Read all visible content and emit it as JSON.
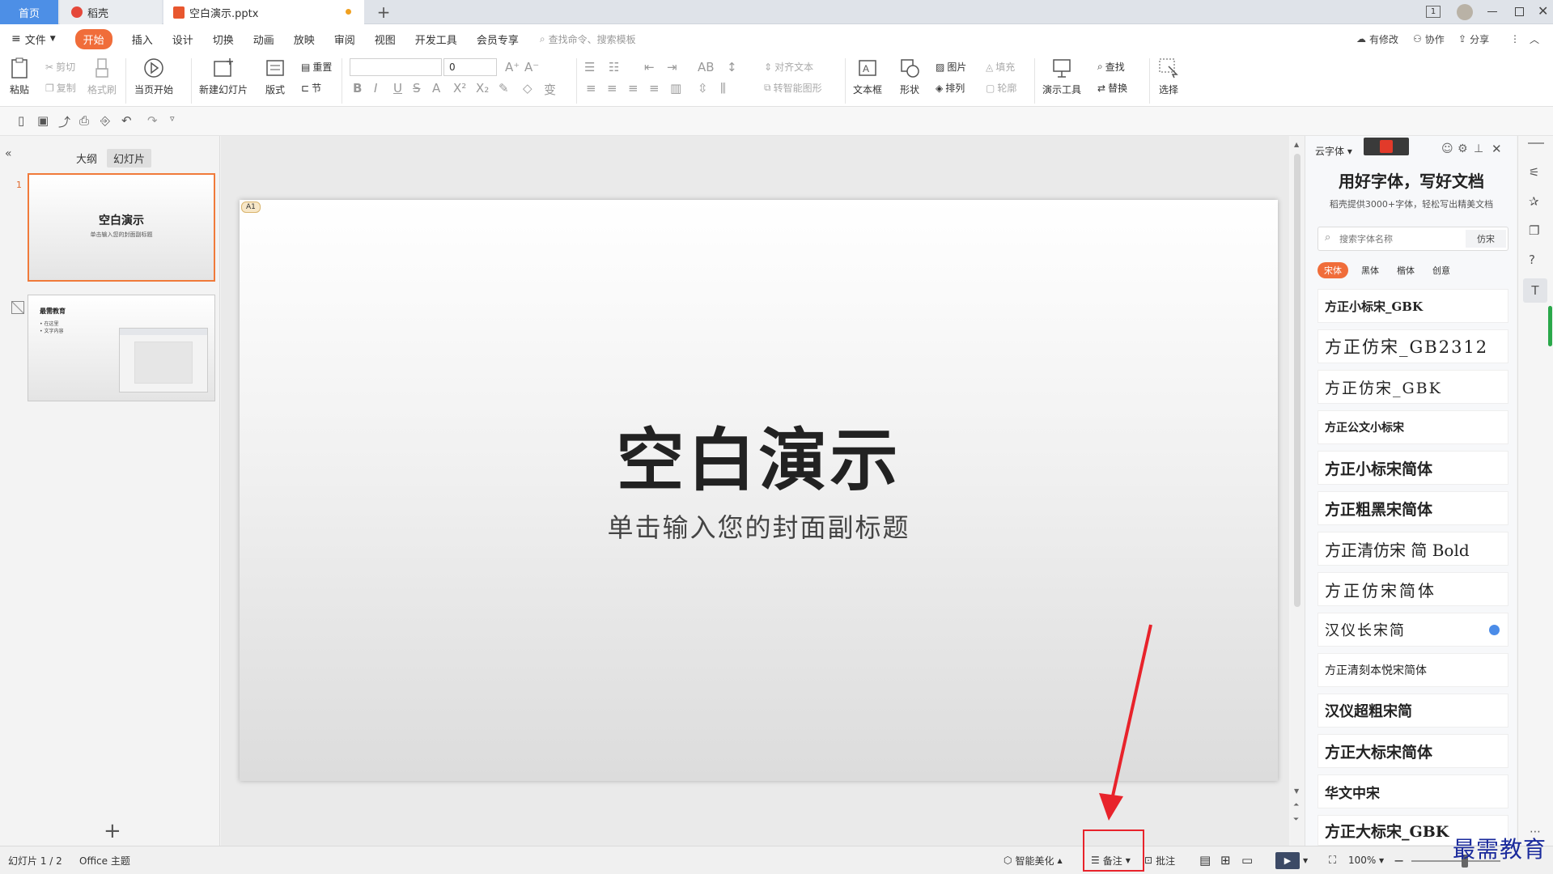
{
  "tabs": {
    "home": "首页",
    "daoke": "稻壳",
    "file": "空白演示.pptx",
    "new_tab": "+"
  },
  "window": {
    "badge": "1"
  },
  "menu": {
    "file": "文件",
    "items": [
      "开始",
      "插入",
      "设计",
      "切换",
      "动画",
      "放映",
      "审阅",
      "视图",
      "开发工具",
      "会员专享"
    ],
    "search": "查找命令、搜索模板",
    "has_changes": "有修改",
    "collab": "协作",
    "share": "分享"
  },
  "ribbon": {
    "paste": "粘贴",
    "cut": "剪切",
    "copy": "复制",
    "format_painter": "格式刷",
    "from_current": "当页开始",
    "new_slide": "新建幻灯片",
    "layout": "版式",
    "reset": "重置",
    "section": "节",
    "font_size": "0",
    "align_text": "对齐文本",
    "smart_art": "转智能图形",
    "textbox": "文本框",
    "shape": "形状",
    "picture": "图片",
    "arrange": "排列",
    "fill": "填充",
    "outline": "轮廓",
    "present_tools": "演示工具",
    "find": "查找",
    "replace": "替换",
    "select": "选择"
  },
  "left_panel": {
    "outline_tab": "大纲",
    "slides_tab": "幻灯片",
    "slide1_no": "1",
    "thumb1_title": "空白演示",
    "thumb1_sub": "单击输入您的封面副标题",
    "thumb2_title": "最需教育",
    "thumb2_b1": "• 在这里",
    "thumb2_b2": "• 文字内容",
    "add_slide": "+"
  },
  "slide": {
    "title": "空白演示",
    "subtitle": "单击输入您的封面副标题",
    "tag": "A1"
  },
  "font_panel": {
    "cloud_font": "云字体",
    "headline": "用好字体，写好文档",
    "sub": "稻壳提供3000+字体，轻松写出精美文档",
    "search_placeholder": "搜索字体名称",
    "search_value": "仿宋",
    "categories": [
      "宋体",
      "黑体",
      "楷体",
      "创意"
    ],
    "fonts": [
      "方正小标宋_GBK",
      "方正仿宋_GB2312",
      "方正仿宋_GBK",
      "方正公文小标宋",
      "方正小标宋简体",
      "方正粗黑宋简体",
      "方正清仿宋 简 Bold",
      "方正仿宋简体",
      "汉仪长宋简",
      "方正清刻本悦宋简体",
      "汉仪超粗宋简",
      "方正大标宋简体",
      "华文中宋",
      "方正大标宋_GBK"
    ]
  },
  "status": {
    "slide_count": "幻灯片 1 / 2",
    "theme": "Office 主题",
    "beautify": "智能美化",
    "notes": "备注",
    "comments": "批注",
    "zoom": "100%"
  },
  "watermark": "最需教育",
  "colors": {
    "accent": "#f06d3a",
    "tab_home": "#4d8fe6",
    "annotation_red": "#e8232b",
    "watermark_blue": "#1a2a9c"
  }
}
